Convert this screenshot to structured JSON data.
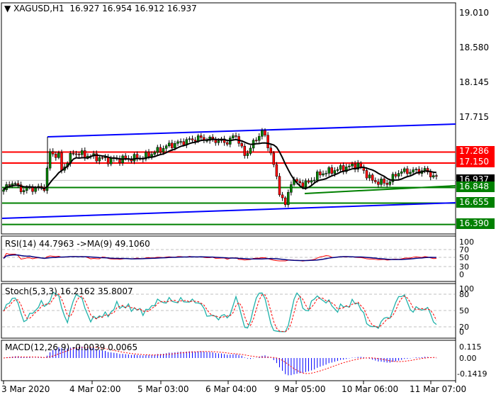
{
  "header": {
    "symbol": "XAGUSD,H1",
    "open": "16.927",
    "high": "16.954",
    "low": "16.912",
    "close": "16.937"
  },
  "price_scale": [
    "19.010",
    "18.580",
    "18.145",
    "17.715"
  ],
  "levels": {
    "resistance_2": {
      "value": "17.286",
      "color": "#ff0000"
    },
    "resistance_1": {
      "value": "17.150",
      "color": "#ff0000"
    },
    "current": {
      "value": "16.937",
      "color": "#000000"
    },
    "support_1": {
      "value": "16.848",
      "color": "#008000"
    },
    "support_2": {
      "value": "16.655",
      "color": "#008000"
    },
    "support_3": {
      "value": "16.390",
      "color": "#008000"
    }
  },
  "rsi": {
    "label": "RSI(14) 44.7963  ->MA(9) 49.1060",
    "scale": [
      "100",
      "70",
      "50",
      "30",
      "0"
    ]
  },
  "stoch": {
    "label": "Stoch(5,3,3) 16.2162 35.8007",
    "scale": [
      "100",
      "80",
      "50",
      "20",
      "0"
    ]
  },
  "macd": {
    "label": "MACD(12,26,9) -0.0039 0.0065",
    "scale": [
      "0.115",
      "0.00",
      "-0.1419"
    ]
  },
  "time_axis": [
    "3 Mar 2020",
    "4 Mar 02:00",
    "5 Mar 03:00",
    "6 Mar 04:00",
    "9 Mar 05:00",
    "10 Mar 06:00",
    "11 Mar 07:00"
  ],
  "chart_data": {
    "type": "candlestick",
    "symbol": "XAGUSD",
    "timeframe": "H1",
    "ylim": [
      16.29,
      19.13
    ],
    "close_keypoints": [
      [
        0,
        16.82
      ],
      [
        3,
        16.92
      ],
      [
        6,
        16.82
      ],
      [
        14,
        16.85
      ],
      [
        16,
        17.28
      ],
      [
        19,
        17.24
      ],
      [
        20,
        17.06
      ],
      [
        24,
        17.28
      ],
      [
        36,
        17.19
      ],
      [
        48,
        17.22
      ],
      [
        57,
        17.37
      ],
      [
        67,
        17.46
      ],
      [
        77,
        17.41
      ],
      [
        80,
        17.5
      ],
      [
        83,
        17.24
      ],
      [
        89,
        17.55
      ],
      [
        92,
        17.28
      ],
      [
        95,
        16.8
      ],
      [
        97,
        16.62
      ],
      [
        99,
        16.93
      ],
      [
        104,
        16.89
      ],
      [
        109,
        17.02
      ],
      [
        116,
        17.08
      ],
      [
        122,
        17.13
      ],
      [
        127,
        16.93
      ],
      [
        132,
        16.9
      ],
      [
        136,
        17.04
      ],
      [
        145,
        17.06
      ],
      [
        149,
        16.96
      ]
    ],
    "colors": {
      "bull": "#008000",
      "bear": "#ff0000",
      "ma": "#000000",
      "channel": "#0000ff"
    }
  }
}
